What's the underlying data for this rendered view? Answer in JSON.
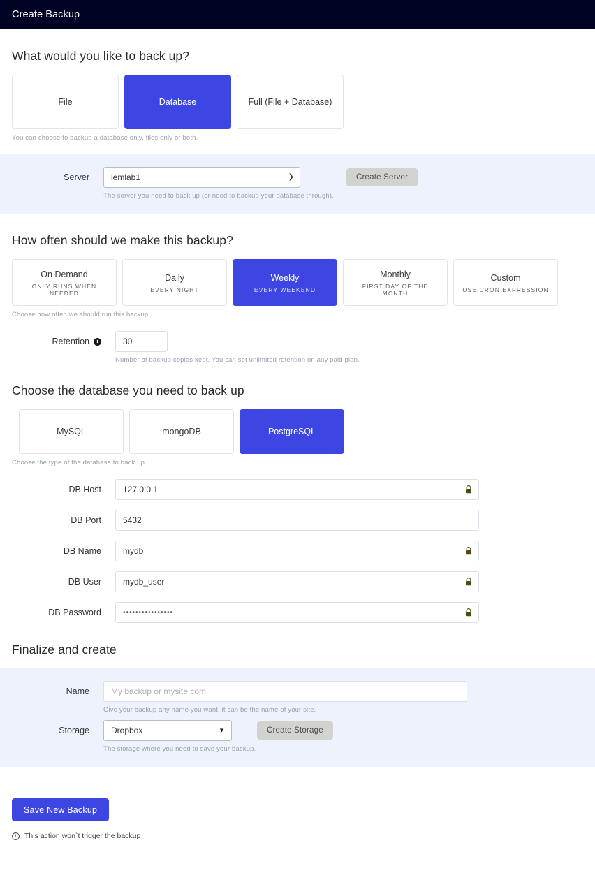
{
  "header": {
    "title": "Create Backup"
  },
  "backup_type": {
    "heading": "What would you like to back up?",
    "options": [
      {
        "label": "File",
        "selected": false
      },
      {
        "label": "Database",
        "selected": true
      },
      {
        "label": "Full (File + Database)",
        "selected": false
      }
    ],
    "helper": "You can choose to backup a database only, files only or both."
  },
  "server_panel": {
    "label": "Server",
    "value": "lemlab1",
    "button": "Create Server",
    "helper": "The server you need to back up (or need to backup your database through)."
  },
  "frequency": {
    "heading": "How often should we make this backup?",
    "options": [
      {
        "label": "On Demand",
        "sub": "ONLY RUNS WHEN NEEDED",
        "selected": false
      },
      {
        "label": "Daily",
        "sub": "EVERY NIGHT",
        "selected": false
      },
      {
        "label": "Weekly",
        "sub": "EVERY WEEKEND",
        "selected": true
      },
      {
        "label": "Monthly",
        "sub": "FIRST DAY OF THE MONTH",
        "selected": false
      },
      {
        "label": "Custom",
        "sub": "USE CRON EXPRESSION",
        "selected": false
      }
    ],
    "helper": "Choose how often we should run this backup.",
    "retention": {
      "label": "Retention",
      "info_icon": "info-icon",
      "value": "30",
      "helper": "Number of backup copies kept. You can set unlimited retention on any paid plan."
    }
  },
  "database": {
    "heading": "Choose the database you need to back up",
    "options": [
      {
        "label": "MySQL",
        "selected": false
      },
      {
        "label": "mongoDB",
        "selected": false
      },
      {
        "label": "PostgreSQL",
        "selected": true
      }
    ],
    "helper": "Choose the type of the database to back up.",
    "fields": [
      {
        "label": "DB Host",
        "value": "127.0.0.1",
        "locked": true,
        "icon": "lock-icon"
      },
      {
        "label": "DB Port",
        "value": "5432",
        "locked": false,
        "icon": ""
      },
      {
        "label": "DB Name",
        "value": "mydb",
        "locked": true,
        "icon": "lock-icon"
      },
      {
        "label": "DB User",
        "value": "mydb_user",
        "locked": true,
        "icon": "lock-icon"
      },
      {
        "label": "DB Password",
        "value": "••••••••••••••••",
        "locked": true,
        "icon": "lock-icon"
      }
    ]
  },
  "finalize": {
    "heading": "Finalize and create",
    "name": {
      "label": "Name",
      "value": "",
      "placeholder": "My backup or mysite.com",
      "helper": "Give your backup any name you want, it can be the name of your site."
    },
    "storage": {
      "label": "Storage",
      "value": "Dropbox",
      "button": "Create Storage",
      "helper": "The storage where you need to save your backup."
    }
  },
  "footer": {
    "save_label": "Save New Backup",
    "note_icon": "info-circle-icon",
    "note": "This action won`t trigger the backup"
  },
  "colors": {
    "accent": "#3D46E3",
    "header_bg": "#000224",
    "panel_bg": "#EEF2FD",
    "grey_button": "#D2D2CF"
  }
}
